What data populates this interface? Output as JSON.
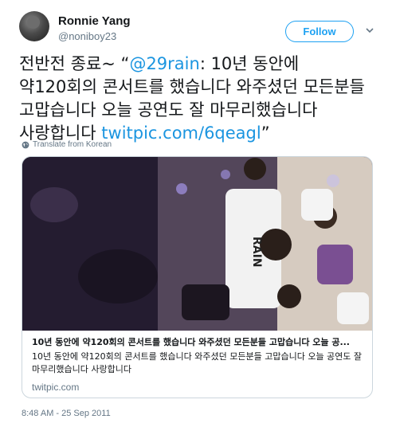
{
  "user": {
    "display_name": "Ronnie Yang",
    "handle": "@noniboy23"
  },
  "follow_button": {
    "label": "Follow"
  },
  "tweet": {
    "text_prefix": "전반전 종료~ “",
    "mention": "@29rain",
    "text_body": ": 10년 동안에 약120회의 콘서트를 했습니다 와주셨던 모든분들 고맙습니다 오늘 공연도 잘 마무리했습니다 사랑합니다 ",
    "link": "twitpic.com/6qeagl",
    "text_suffix": "”"
  },
  "translate": {
    "label": "Translate from Korean",
    "icon": "globe-icon"
  },
  "card": {
    "image_alt": "concert photo",
    "shirt_text": "RAIN",
    "title": "10년 동안에 약120회의 콘서트를 했습니다 와주셨던 모든분들 고맙습니다 오늘 공...",
    "description": "10년 동안에 약120회의 콘서트를 했습니다 와주셨던 모든분들 고맙습니다 오늘 공연도 잘 마무리했습니다 사랑합니다",
    "domain": "twitpic.com"
  },
  "timestamp": "8:48 AM - 25 Sep 2011",
  "colors": {
    "accent": "#1da1f2",
    "link": "#1b95e0",
    "muted": "#657786"
  }
}
